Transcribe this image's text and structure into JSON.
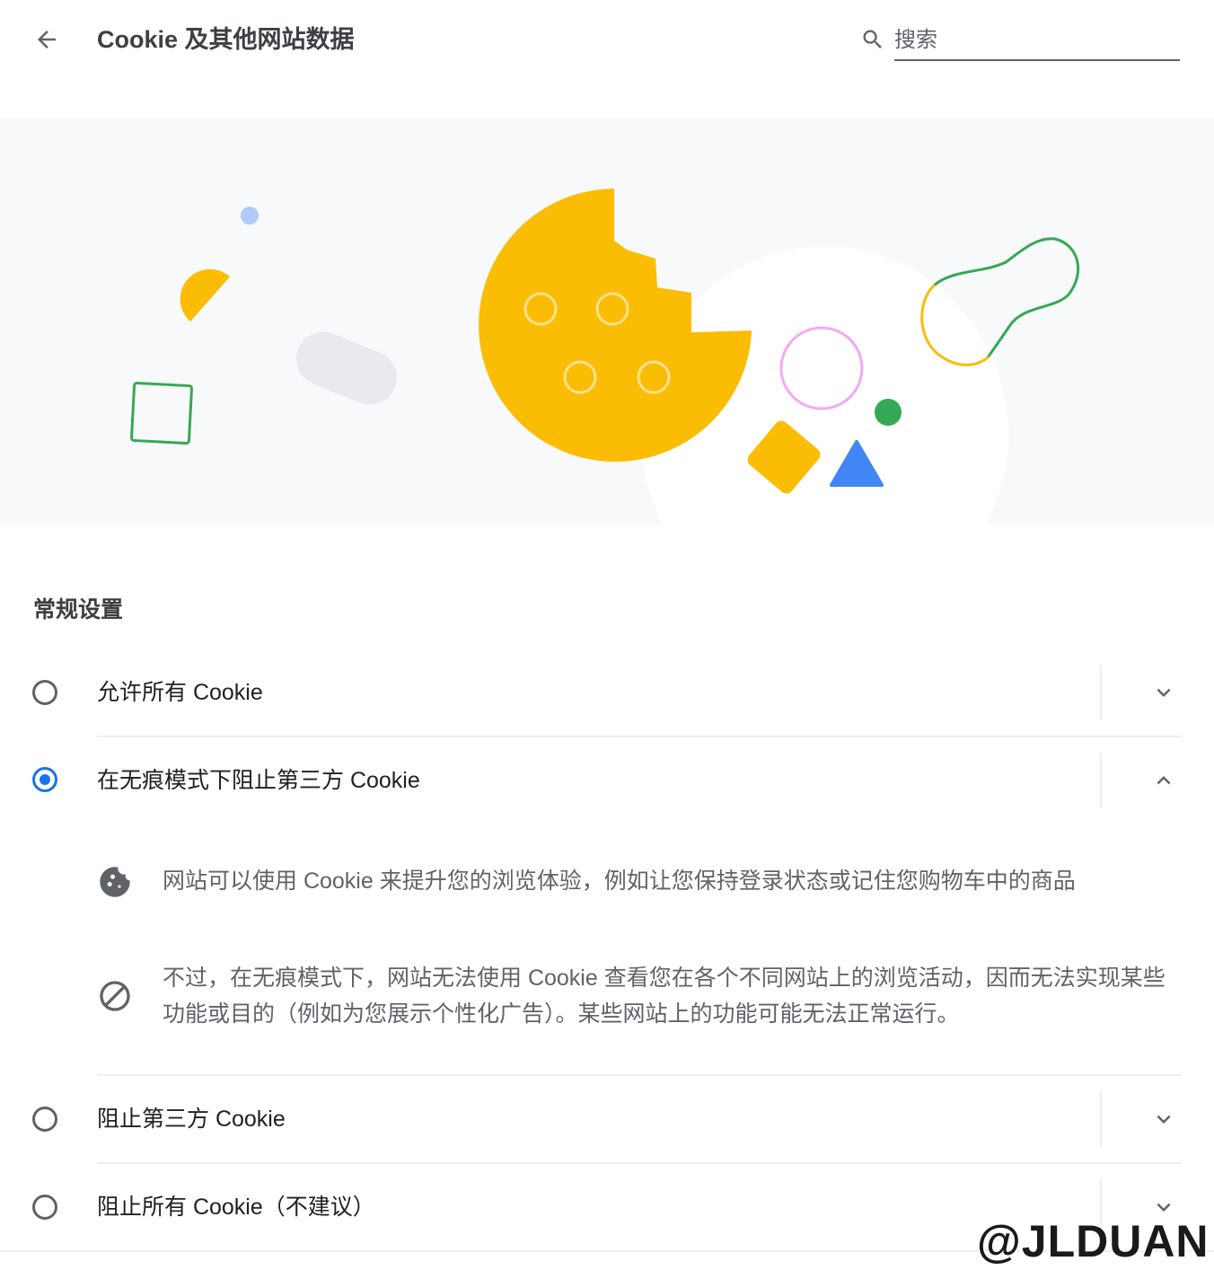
{
  "header": {
    "title": "Cookie 及其他网站数据",
    "search_placeholder": "搜索"
  },
  "icons": {
    "back": "arrow-back-icon",
    "search": "search-icon",
    "expand": "chevron-down-icon",
    "collapse": "chevron-up-icon",
    "cookie": "cookie-icon",
    "block": "block-icon"
  },
  "colors": {
    "accent": "#1a73e8",
    "cookie_yellow": "#fbbc04",
    "green": "#34a853",
    "blue": "#4285f4",
    "pink": "#f4a8f4"
  },
  "section": {
    "title": "常规设置"
  },
  "options": [
    {
      "label": "允许所有 Cookie",
      "selected": false,
      "expanded": false
    },
    {
      "label": "在无痕模式下阻止第三方 Cookie",
      "selected": true,
      "expanded": true
    },
    {
      "label": "阻止第三方 Cookie",
      "selected": false,
      "expanded": false
    },
    {
      "label": "阻止所有 Cookie（不建议）",
      "selected": false,
      "expanded": false
    }
  ],
  "details": [
    {
      "text": "网站可以使用 Cookie 来提升您的浏览体验，例如让您保持登录状态或记住您购物车中的商品"
    },
    {
      "text": "不过，在无痕模式下，网站无法使用 Cookie 查看您在各个不同网站上的浏览活动，因而无法实现某些功能或目的（例如为您展示个性化广告）。某些网站上的功能可能无法正常运行。"
    }
  ],
  "watermark": "@JLDUAN"
}
